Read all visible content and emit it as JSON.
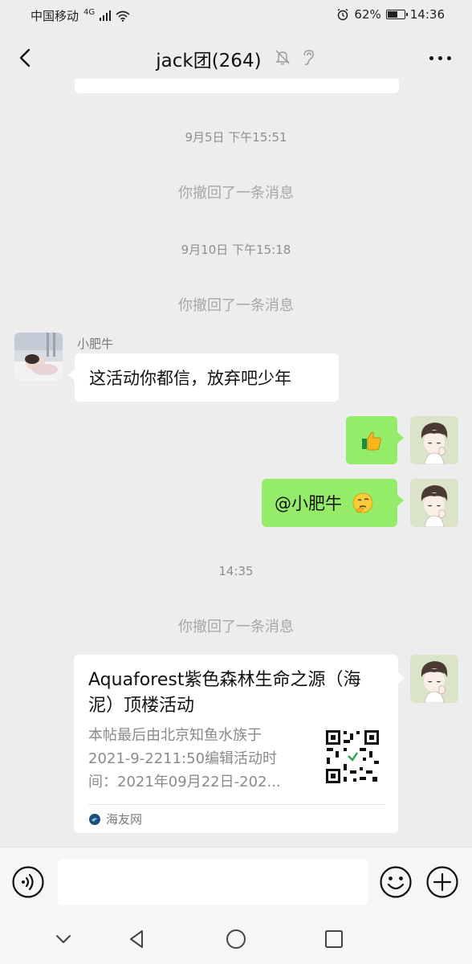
{
  "status_bar": {
    "carrier": "中国移动",
    "network": "4G",
    "battery": "62%",
    "battery_level": 0.62,
    "time": "14:36"
  },
  "header": {
    "title": "jack团(264)",
    "icons": [
      "back-arrow-icon",
      "mute-bell-icon",
      "earpiece-icon",
      "more-dots-icon"
    ]
  },
  "chat": {
    "ts1": "9月5日 下午15:51",
    "sys1": "你撤回了一条消息",
    "ts2": "9月10日 下午15:18",
    "sys2": "你撤回了一条消息",
    "sender_name": "小肥牛",
    "msg_received": "这活动你都信，放弃吧少年",
    "msg_sent_thumb_icon": "thumbs-up-emoji",
    "msg_sent_mention": "@小肥牛",
    "msg_sent_mention_emoji": "thinking-face-emoji",
    "ts3": "14:35",
    "sys3": "你撤回了一条消息",
    "card": {
      "title": "Aquaforest紫色森林生命之源（海泥）顶楼活动",
      "description": "本帖最后由北京知鱼水族于2021-9-2211:50编辑活动时间：2021年09月22日-202...",
      "source": "海友网"
    }
  },
  "input_bar": {
    "placeholder": "",
    "icons": [
      "voice-icon",
      "emoji-icon",
      "plus-icon"
    ]
  },
  "nav_bar": {
    "icons": [
      "collapse-icon",
      "back-triangle-icon",
      "home-circle-icon",
      "recents-square-icon"
    ]
  },
  "colors": {
    "background": "#ededed",
    "sent_bubble": "#95ec69",
    "received_bubble": "#ffffff"
  }
}
